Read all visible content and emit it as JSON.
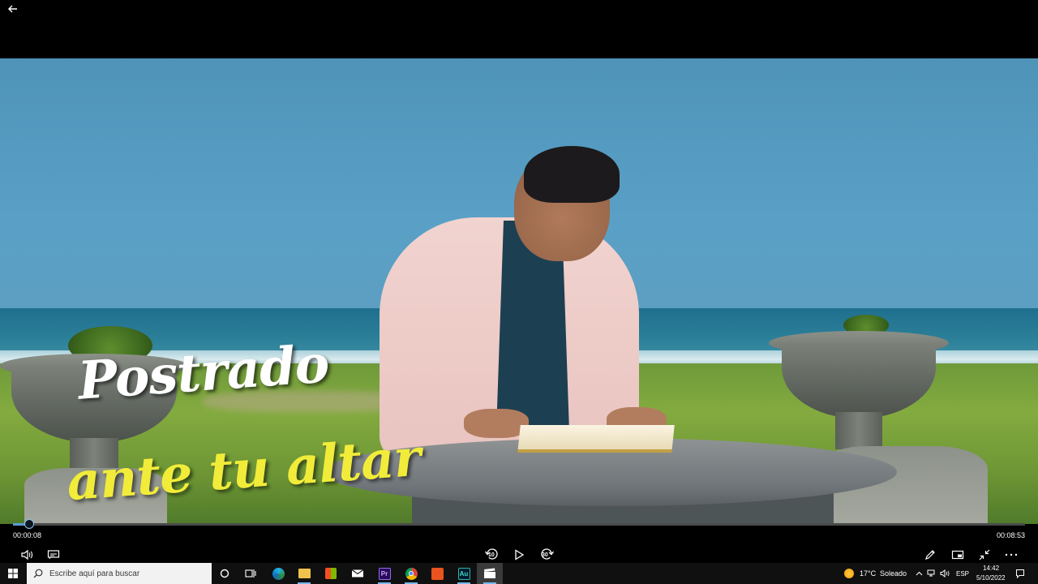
{
  "video": {
    "title_line1": "Postrado",
    "title_line2": "ante tu altar"
  },
  "player": {
    "current_time": "00:00:08",
    "total_time": "00:08:53",
    "progress_fraction": 0.0157,
    "skip_back_label": "10",
    "skip_forward_label": "30"
  },
  "taskbar": {
    "search_placeholder": "Escribe aquí para buscar",
    "apps": [
      {
        "name": "cortana",
        "label": ""
      },
      {
        "name": "task-view",
        "label": ""
      },
      {
        "name": "edge",
        "label": ""
      },
      {
        "name": "file-explorer",
        "label": ""
      },
      {
        "name": "store",
        "label": ""
      },
      {
        "name": "mail",
        "label": ""
      },
      {
        "name": "premiere",
        "label": "Pr"
      },
      {
        "name": "chrome",
        "label": ""
      },
      {
        "name": "office",
        "label": ""
      },
      {
        "name": "audition",
        "label": "Au"
      },
      {
        "name": "movies-tv",
        "label": ""
      }
    ],
    "weather": {
      "temp": "17°C",
      "condition": "Soleado"
    },
    "language": "ESP",
    "clock_time": "14:42",
    "clock_date": "5/10/2022"
  },
  "colors": {
    "accent": "#5b9bd5",
    "title_white": "#ffffff",
    "title_yellow": "#f1ec3a",
    "taskbar_bg": "#101010"
  }
}
